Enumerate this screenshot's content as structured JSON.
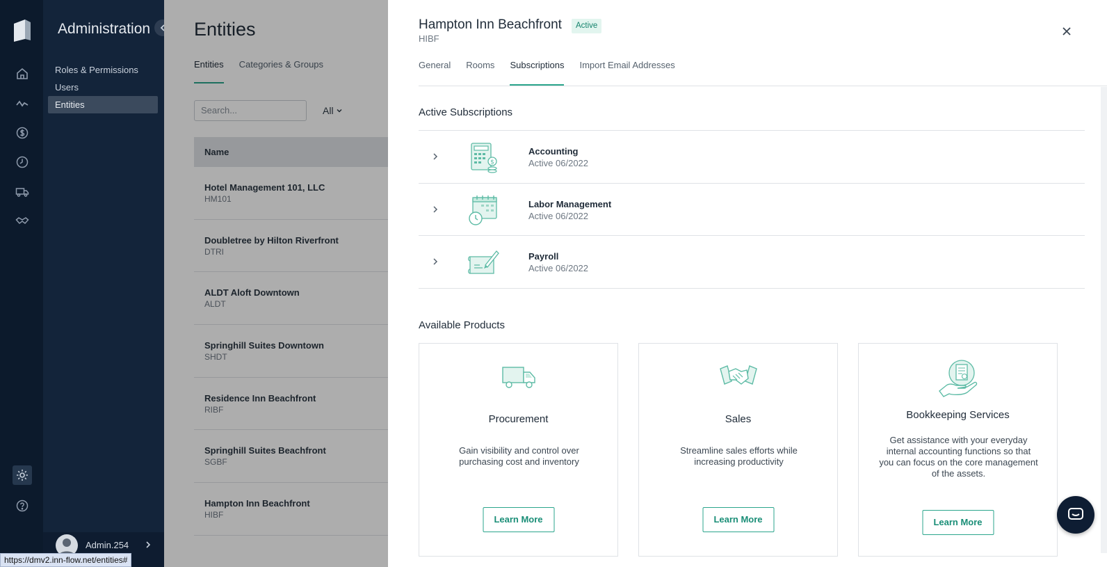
{
  "rail": {
    "icons": [
      "logo-icon",
      "home-icon",
      "activity-icon",
      "dollar-icon",
      "clock-icon",
      "truck-icon",
      "handshake-icon",
      "settings-icon",
      "help-icon"
    ]
  },
  "sidebar": {
    "title": "Administration",
    "items": [
      {
        "label": "Roles & Permissions",
        "active": false
      },
      {
        "label": "Users",
        "active": false
      },
      {
        "label": "Entities",
        "active": true
      }
    ],
    "user": "Admin.254"
  },
  "background_page": {
    "title": "Entities",
    "tabs": [
      {
        "label": "Entities",
        "active": true
      },
      {
        "label": "Categories & Groups",
        "active": false
      }
    ],
    "search_placeholder": "Search...",
    "filter_value": "All",
    "table_header": "Name",
    "rows": [
      {
        "name": "Hotel Management 101, LLC",
        "code": "HM101"
      },
      {
        "name": "Doubletree by Hilton Riverfront",
        "code": "DTRI"
      },
      {
        "name": "ALDT Aloft Downtown",
        "code": "ALDT"
      },
      {
        "name": "Springhill Suites Downtown",
        "code": "SHDT"
      },
      {
        "name": "Residence Inn Beachfront",
        "code": "RIBF"
      },
      {
        "name": "Springhill Suites Beachfront",
        "code": "SGBF"
      },
      {
        "name": "Hampton Inn Beachfront",
        "code": "HIBF"
      }
    ]
  },
  "panel": {
    "name": "Hampton Inn Beachfront",
    "status": "Active",
    "code": "HIBF",
    "tabs": [
      {
        "label": "General",
        "active": false
      },
      {
        "label": "Rooms",
        "active": false
      },
      {
        "label": "Subscriptions",
        "active": true
      },
      {
        "label": "Import Email Addresses",
        "active": false
      }
    ],
    "active_title": "Active Subscriptions",
    "subscriptions": [
      {
        "name": "Accounting",
        "status": "Active 06/2022",
        "icon": "accounting-icon"
      },
      {
        "name": "Labor Management",
        "status": "Active 06/2022",
        "icon": "calendar-clock-icon"
      },
      {
        "name": "Payroll",
        "status": "Active 06/2022",
        "icon": "check-pen-icon"
      }
    ],
    "available_title": "Available Products",
    "products": [
      {
        "name": "Procurement",
        "description": "Gain visibility and control over purchasing cost and inventory",
        "button": "Learn More",
        "icon": "truck-icon"
      },
      {
        "name": "Sales",
        "description": "Streamline sales efforts while increasing productivity",
        "button": "Learn More",
        "icon": "handshake-icon"
      },
      {
        "name": "Bookkeeping Services",
        "description": "Get assistance with your everyday internal accounting functions so that you can focus on the core management of the assets.",
        "button": "Learn More",
        "icon": "hand-document-icon"
      }
    ]
  },
  "status_url": "https://dmv2.inn-flow.net/entities#",
  "colors": {
    "accent": "#2ba58c",
    "rail": "#0c1a2c",
    "sidebar": "#13243a"
  }
}
